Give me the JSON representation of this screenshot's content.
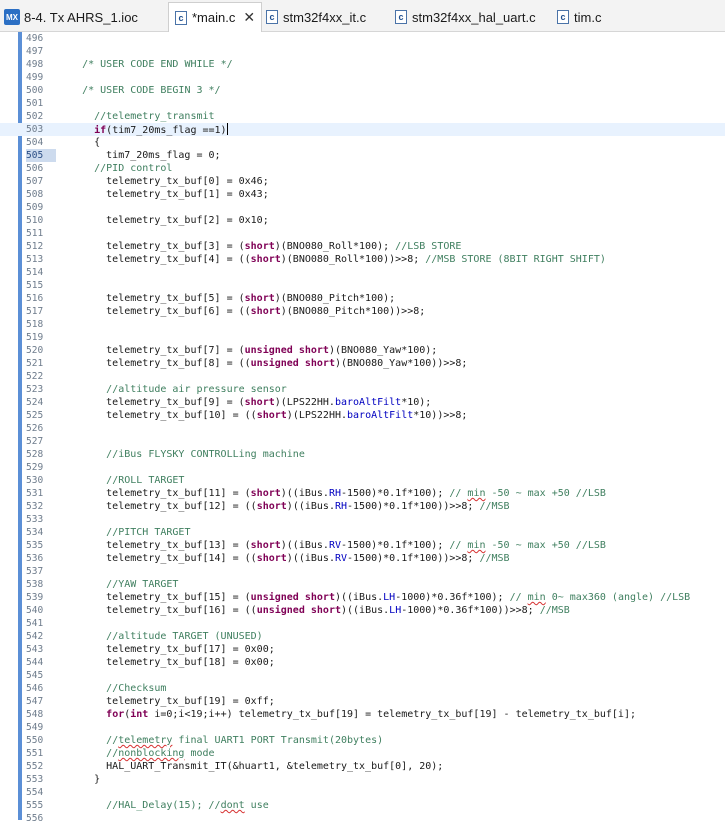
{
  "tabs": [
    {
      "icon": "mx-icon",
      "label": "8-4. Tx AHRS_1.ioc",
      "active": false
    },
    {
      "icon": "c-file-icon",
      "label": "*main.c",
      "active": true,
      "close": "✕"
    },
    {
      "icon": "c-file-icon",
      "label": "stm32f4xx_it.c",
      "active": false
    },
    {
      "icon": "c-file-icon",
      "label": "stm32f4xx_hal_uart.c",
      "active": false
    },
    {
      "icon": "c-file-icon",
      "label": "tim.c",
      "active": false
    }
  ],
  "code_lines": [
    {
      "n": "496",
      "code": ""
    },
    {
      "n": "497",
      "code": ""
    },
    {
      "n": "498",
      "code": "    /* USER CODE END WHILE */"
    },
    {
      "n": "499",
      "code": ""
    },
    {
      "n": "500",
      "code": "    /* USER CODE BEGIN 3 */"
    },
    {
      "n": "501",
      "code": ""
    },
    {
      "n": "502",
      "code": "      //telemetry_transmit"
    },
    {
      "n": "503",
      "code": "      if(tim7_20ms_flag ==1)"
    },
    {
      "n": "504",
      "code": "      {"
    },
    {
      "n": "505",
      "code": "        tim7_20ms_flag = 0;"
    },
    {
      "n": "506",
      "code": "      //PID control"
    },
    {
      "n": "507",
      "code": "        telemetry_tx_buf[0] = 0x46;"
    },
    {
      "n": "508",
      "code": "        telemetry_tx_buf[1] = 0x43;"
    },
    {
      "n": "509",
      "code": ""
    },
    {
      "n": "510",
      "code": "        telemetry_tx_buf[2] = 0x10;"
    },
    {
      "n": "511",
      "code": ""
    },
    {
      "n": "512",
      "code": "        telemetry_tx_buf[3] = (short)(BNO080_Roll*100); //LSB STORE"
    },
    {
      "n": "513",
      "code": "        telemetry_tx_buf[4] = ((short)(BNO080_Roll*100))>>8; //MSB STORE (8BIT RIGHT SHIFT)"
    },
    {
      "n": "514",
      "code": ""
    },
    {
      "n": "515",
      "code": ""
    },
    {
      "n": "516",
      "code": "        telemetry_tx_buf[5] = (short)(BNO080_Pitch*100);"
    },
    {
      "n": "517",
      "code": "        telemetry_tx_buf[6] = ((short)(BNO080_Pitch*100))>>8;"
    },
    {
      "n": "518",
      "code": ""
    },
    {
      "n": "519",
      "code": ""
    },
    {
      "n": "520",
      "code": "        telemetry_tx_buf[7] = (unsigned short)(BNO080_Yaw*100);"
    },
    {
      "n": "521",
      "code": "        telemetry_tx_buf[8] = ((unsigned short)(BNO080_Yaw*100))>>8;"
    },
    {
      "n": "522",
      "code": ""
    },
    {
      "n": "523",
      "code": "        //altitude air pressure sensor"
    },
    {
      "n": "524",
      "code": "        telemetry_tx_buf[9] = (short)(LPS22HH.baroAltFilt*10);"
    },
    {
      "n": "525",
      "code": "        telemetry_tx_buf[10] = ((short)(LPS22HH.baroAltFilt*10))>>8;"
    },
    {
      "n": "526",
      "code": ""
    },
    {
      "n": "527",
      "code": ""
    },
    {
      "n": "528",
      "code": "        //iBus FLYSKY CONTROLLing machine"
    },
    {
      "n": "529",
      "code": ""
    },
    {
      "n": "530",
      "code": "        //ROLL TARGET"
    },
    {
      "n": "531",
      "code": "        telemetry_tx_buf[11] = (short)((iBus.RH-1500)*0.1f*100); // min -50 ~ max +50 //LSB"
    },
    {
      "n": "532",
      "code": "        telemetry_tx_buf[12] = ((short)((iBus.RH-1500)*0.1f*100))>>8; //MSB"
    },
    {
      "n": "533",
      "code": ""
    },
    {
      "n": "534",
      "code": "        //PITCH TARGET"
    },
    {
      "n": "535",
      "code": "        telemetry_tx_buf[13] = (short)((iBus.RV-1500)*0.1f*100); // min -50 ~ max +50 //LSB"
    },
    {
      "n": "536",
      "code": "        telemetry_tx_buf[14] = ((short)((iBus.RV-1500)*0.1f*100))>>8; //MSB"
    },
    {
      "n": "537",
      "code": ""
    },
    {
      "n": "538",
      "code": "        //YAW TARGET"
    },
    {
      "n": "539",
      "code": "        telemetry_tx_buf[15] = (unsigned short)((iBus.LH-1000)*0.36f*100); // min 0~ max360 (angle) //LSB"
    },
    {
      "n": "540",
      "code": "        telemetry_tx_buf[16] = ((unsigned short)((iBus.LH-1000)*0.36f*100))>>8; //MSB"
    },
    {
      "n": "541",
      "code": ""
    },
    {
      "n": "542",
      "code": "        //altitude TARGET (UNUSED)"
    },
    {
      "n": "543",
      "code": "        telemetry_tx_buf[17] = 0x00;"
    },
    {
      "n": "544",
      "code": "        telemetry_tx_buf[18] = 0x00;"
    },
    {
      "n": "545",
      "code": ""
    },
    {
      "n": "546",
      "code": "        //Checksum"
    },
    {
      "n": "547",
      "code": "        telemetry_tx_buf[19] = 0xff;"
    },
    {
      "n": "548",
      "code": "        for(int i=0;i<19;i++) telemetry_tx_buf[19] = telemetry_tx_buf[19] - telemetry_tx_buf[i];"
    },
    {
      "n": "549",
      "code": ""
    },
    {
      "n": "550",
      "code": "        //telemetry final UART1 PORT Transmit(20bytes)"
    },
    {
      "n": "551",
      "code": "        //nonblocking mode"
    },
    {
      "n": "552",
      "code": "        HAL_UART_Transmit_IT(&huart1, &telemetry_tx_buf[0], 20);"
    },
    {
      "n": "553",
      "code": "      }"
    },
    {
      "n": "554",
      "code": ""
    },
    {
      "n": "555",
      "code": "        //HAL_Delay(15); //dont use"
    },
    {
      "n": "556",
      "code": ""
    }
  ],
  "colors": {
    "comment": "#3f7f5f",
    "keyword": "#7f0055",
    "field": "#0000c0",
    "line_number": "#6e7c8c",
    "current_line_highlight": "#e8f2fe",
    "marker_bar": "#5b8fd6"
  }
}
